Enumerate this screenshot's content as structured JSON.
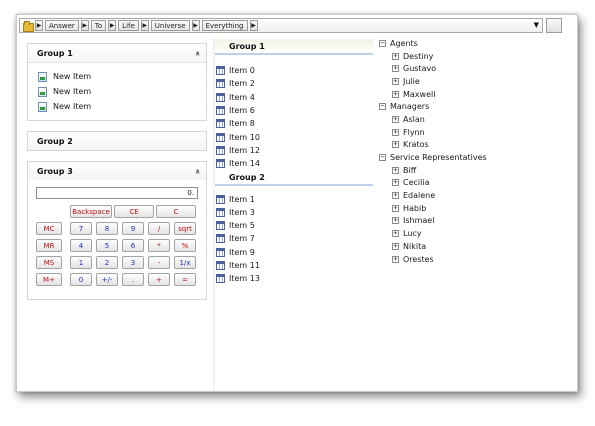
{
  "breadcrumb": {
    "items": [
      "Answer",
      "To",
      "Life",
      "Universe",
      "Everything"
    ]
  },
  "groups": [
    {
      "title": "Group 1",
      "chevron": "»",
      "items": [
        "New Item",
        "New Item",
        "New Item"
      ]
    },
    {
      "title": "Group 2"
    },
    {
      "title": "Group 3",
      "chevron": "»"
    }
  ],
  "calculator": {
    "display": "0.",
    "buttons": {
      "backspace": "Backspace",
      "ce": "CE",
      "c": "C",
      "mc": "MC",
      "mr": "MR",
      "ms": "MS",
      "mplus": "M+",
      "n7": "7",
      "n8": "8",
      "n9": "9",
      "div": "/",
      "sqrt": "sqrt",
      "n4": "4",
      "n5": "5",
      "n6": "6",
      "mul": "*",
      "pct": "%",
      "n1": "1",
      "n2": "2",
      "n3": "3",
      "sub": "-",
      "inv": "1/x",
      "n0": "0",
      "neg": "+/-",
      "dot": ".",
      "add": "+",
      "eq": "="
    }
  },
  "list_groups": [
    {
      "title": "Group 1",
      "items": [
        "Item 0",
        "Item 2",
        "Item 4",
        "Item 6",
        "Item 8",
        "Item 10",
        "Item 12",
        "Item 14"
      ]
    },
    {
      "title": "Group 2",
      "items": [
        "Item 1",
        "Item 3",
        "Item 5",
        "Item 7",
        "Item 9",
        "Item 11",
        "Item 13"
      ]
    }
  ],
  "tree": [
    {
      "label": "Agents",
      "children": [
        "Destiny",
        "Gustavo",
        "Julie",
        "Maxwell"
      ]
    },
    {
      "label": "Managers",
      "children": [
        "Aslan",
        "Flynn",
        "Kratos"
      ]
    },
    {
      "label": "Service Representatives",
      "children": [
        "Biff",
        "Cecilia",
        "Edalene",
        "Habib",
        "Ishmael",
        "Lucy",
        "Nikita",
        "Orestes"
      ]
    }
  ],
  "icons": {
    "folder": "folder-icon",
    "crumb_arrow": "chevron-right-icon",
    "dropdown": "chevron-down-icon",
    "collapse": "collapse-chevron-icon",
    "item": "document-icon",
    "list_item": "calendar-icon",
    "tree_expanded": "minus-icon",
    "tree_collapsed": "plus-icon"
  },
  "glyphs": {
    "arrow": "▶",
    "dropdown": "▼",
    "expanded": "−",
    "collapsed": "+"
  },
  "colors": {
    "accent_blue": "#bcd2ec",
    "calc_red": "#c01010",
    "calc_blue": "#1c2fb5"
  }
}
